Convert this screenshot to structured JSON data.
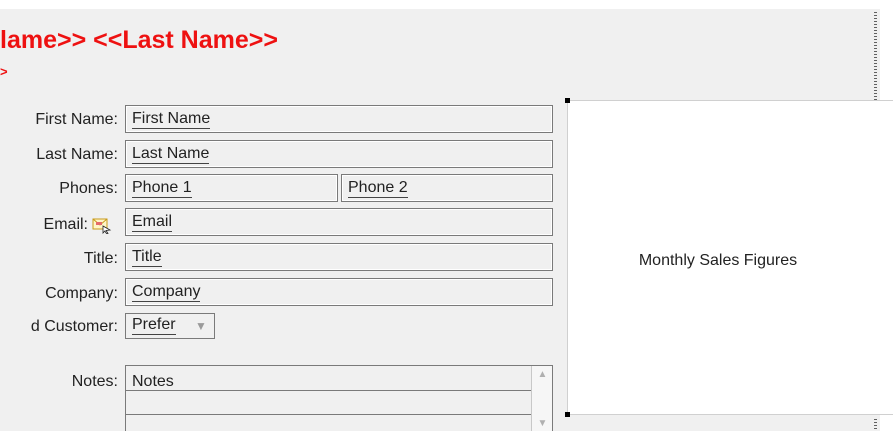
{
  "header": {
    "title": "lame>> <<Last Name>>",
    "subtitle": ">"
  },
  "form": {
    "first_name": {
      "label": "First Name:",
      "value": "First Name"
    },
    "last_name": {
      "label": "Last Name:",
      "value": "Last Name"
    },
    "phones": {
      "label": "Phones:",
      "phone1": "Phone 1",
      "phone2": "Phone 2"
    },
    "email": {
      "label": "Email:",
      "value": "Email",
      "icon": "email-attach-icon"
    },
    "title": {
      "label": "Title:",
      "value": "Title"
    },
    "company": {
      "label": "Company:",
      "value": "Company"
    },
    "preferred_customer": {
      "label": "d Customer:",
      "value": "Prefer"
    },
    "notes": {
      "label": "Notes:",
      "value": "Notes"
    }
  },
  "chart_placeholder": {
    "label": "Monthly Sales Figures"
  },
  "colors": {
    "accent": "#ee1111",
    "form_background": "#f0f0f0",
    "text": "#222222"
  }
}
